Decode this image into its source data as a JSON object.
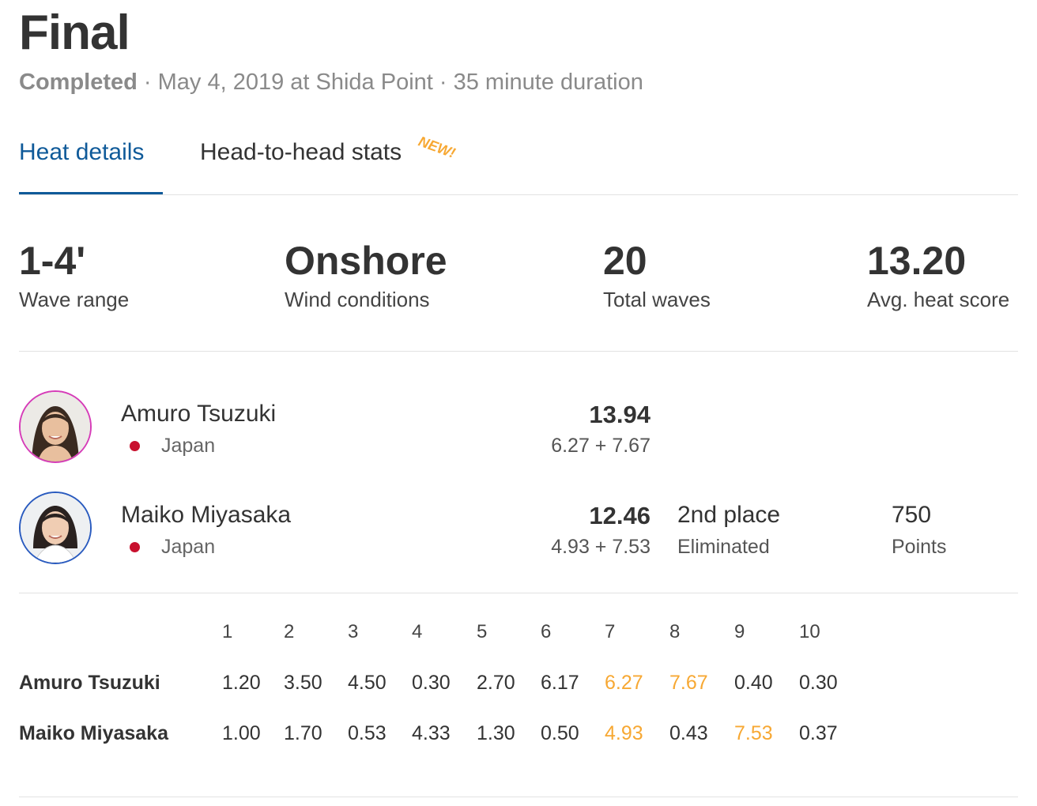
{
  "header": {
    "title": "Final",
    "status": "Completed",
    "details": "· May 4, 2019 at Shida Point · 35 minute duration"
  },
  "tabs": [
    {
      "label": "Heat details",
      "active": true
    },
    {
      "label": "Head-to-head stats",
      "active": false,
      "badge": "NEW!"
    }
  ],
  "stats": [
    {
      "value": "1-4'",
      "label": "Wave range"
    },
    {
      "value": "Onshore",
      "label": "Wind conditions"
    },
    {
      "value": "20",
      "label": "Total waves"
    },
    {
      "value": "13.20",
      "label": "Avg. heat score"
    }
  ],
  "athletes": [
    {
      "name": "Amuro Tsuzuki",
      "country": "Japan",
      "total": "13.94",
      "breakdown": "6.27 + 7.67",
      "ring_color": "#d63cb8"
    },
    {
      "name": "Maiko Miyasaka",
      "country": "Japan",
      "total": "12.46",
      "breakdown": "4.93 + 7.53",
      "place": "2nd place",
      "place_status": "Eliminated",
      "points": "750",
      "points_label": "Points",
      "ring_color": "#2a5bbf"
    }
  ],
  "wave_table": {
    "headers": [
      "1",
      "2",
      "3",
      "4",
      "5",
      "6",
      "7",
      "8",
      "9",
      "10"
    ],
    "rows": [
      {
        "name": "Amuro Tsuzuki",
        "scores": [
          "1.20",
          "3.50",
          "4.50",
          "0.30",
          "2.70",
          "6.17",
          "6.27",
          "7.67",
          "0.40",
          "0.30"
        ],
        "highlight": [
          6,
          7
        ]
      },
      {
        "name": "Maiko Miyasaka",
        "scores": [
          "1.00",
          "1.70",
          "0.53",
          "4.33",
          "1.30",
          "0.50",
          "4.93",
          "0.43",
          "7.53",
          "0.37"
        ],
        "highlight": [
          6,
          8
        ]
      }
    ]
  },
  "colors": {
    "accent": "#0f5a99",
    "highlight": "#f7a833",
    "flag": "#c8102e"
  }
}
